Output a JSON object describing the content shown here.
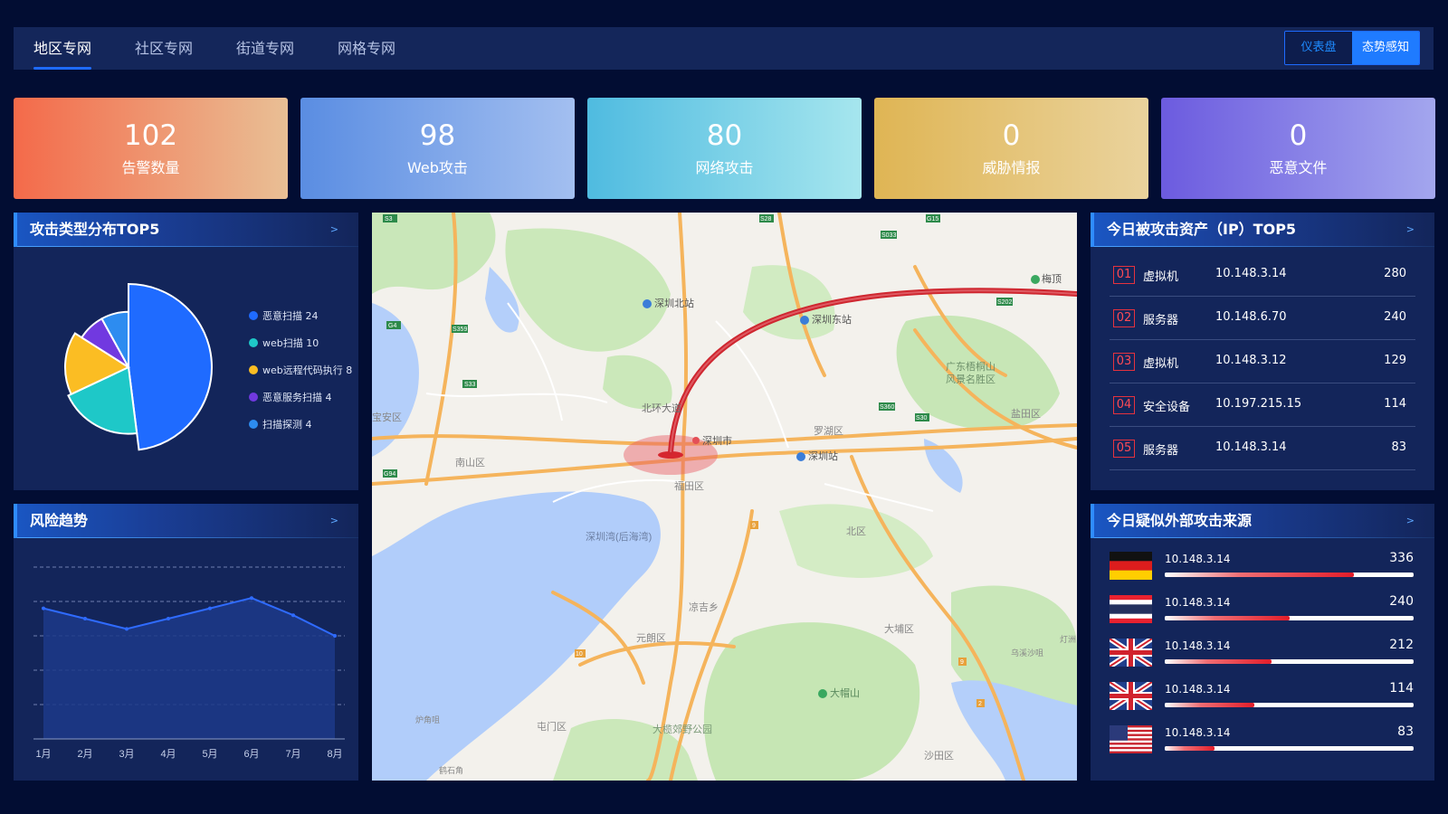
{
  "nav": {
    "tabs": [
      "地区专网",
      "社区专网",
      "街道专网",
      "网格专网"
    ],
    "active_tab": 0,
    "view_toggle": [
      "仪表盘",
      "态势感知"
    ],
    "active_view": 1
  },
  "stats": [
    {
      "value": "102",
      "label": "告警数量",
      "colors": [
        "#f46a4a",
        "#e9bf95"
      ]
    },
    {
      "value": "98",
      "label": "Web攻击",
      "colors": [
        "#5a8de2",
        "#a3bff0"
      ]
    },
    {
      "value": "80",
      "label": "网络攻击",
      "colors": [
        "#4fbbe0",
        "#a6e6ee"
      ]
    },
    {
      "value": "0",
      "label": "威胁情报",
      "colors": [
        "#dfb554",
        "#ead39d"
      ]
    },
    {
      "value": "0",
      "label": "恶意文件",
      "colors": [
        "#6c5bdf",
        "#a3a6ee"
      ]
    }
  ],
  "attack_types": {
    "title": "攻击类型分布TOP5",
    "arrow": ">",
    "items": [
      {
        "label": "恶意扫描",
        "value": 24,
        "color": "#1f6bff"
      },
      {
        "label": "web扫描",
        "value": 10,
        "color": "#1ec8c8"
      },
      {
        "label": "web远程代码执行",
        "value": 8,
        "color": "#fbbd23"
      },
      {
        "label": "恶意服务扫描",
        "value": 4,
        "color": "#7139e0"
      },
      {
        "label": "扫描探测",
        "value": 4,
        "color": "#2d8cf0"
      }
    ]
  },
  "risk_trend": {
    "title": "风险趋势",
    "arrow": ">",
    "chart_data": {
      "type": "area",
      "categories": [
        "1月",
        "2月",
        "3月",
        "4月",
        "5月",
        "6月",
        "7月",
        "8月"
      ],
      "values": [
        38,
        35,
        32,
        35,
        38,
        41,
        36,
        30
      ],
      "ylim": [
        0,
        50
      ],
      "grid": true,
      "line_color": "#2f6bff",
      "fill_color": "#1d3a8a"
    }
  },
  "map": {
    "labels": [
      "深圳北站",
      "深圳东站",
      "广东梧桐山风景名胜区",
      "北环大道",
      "深圳市",
      "罗湖区",
      "深圳站",
      "盐田区",
      "宝安区",
      "南山区",
      "福田区",
      "深圳湾(后海湾)",
      "北区",
      "大埔区",
      "元朗区",
      "屯门区",
      "大帽山",
      "大榄郊野公园",
      "乌溪沙咀",
      "沙田区",
      "炉角咀",
      "鹤石角",
      "凉吉乡",
      "梅顶",
      "灯洲"
    ],
    "roads": [
      "G4",
      "S359",
      "S33",
      "G94",
      "S3",
      "S202",
      "S360",
      "S30",
      "G15",
      "S28",
      "S033",
      "9",
      "10",
      "9",
      "2"
    ]
  },
  "assets": {
    "title": "今日被攻击资产（IP）TOP5",
    "arrow": ">",
    "rows": [
      {
        "rank": "01",
        "type": "虚拟机",
        "ip": "10.148.3.14",
        "count": "280"
      },
      {
        "rank": "02",
        "type": "服务器",
        "ip": "10.148.6.70",
        "count": "240"
      },
      {
        "rank": "03",
        "type": "虚拟机",
        "ip": "10.148.3.12",
        "count": "129"
      },
      {
        "rank": "04",
        "type": "安全设备",
        "ip": "10.197.215.15",
        "count": "114"
      },
      {
        "rank": "05",
        "type": "服务器",
        "ip": "10.148.3.14",
        "count": "83"
      }
    ]
  },
  "sources": {
    "title": "今日疑似外部攻击来源",
    "arrow": ">",
    "rows": [
      {
        "flag": "germany-flag",
        "ip": "10.148.3.14",
        "value": "336",
        "ratio": 0.76
      },
      {
        "flag": "thailand-flag",
        "ip": "10.148.3.14",
        "value": "240",
        "ratio": 0.5
      },
      {
        "flag": "uk-flag",
        "ip": "10.148.3.14",
        "value": "212",
        "ratio": 0.43
      },
      {
        "flag": "uk-flag",
        "ip": "10.148.3.14",
        "value": "114",
        "ratio": 0.36
      },
      {
        "flag": "usa-flag",
        "ip": "10.148.3.14",
        "value": "83",
        "ratio": 0.2
      }
    ]
  }
}
